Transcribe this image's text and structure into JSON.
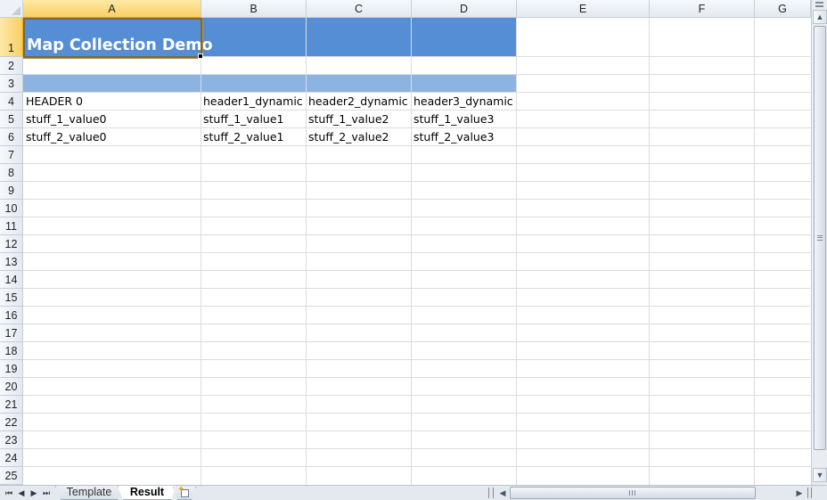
{
  "columns": [
    "A",
    "B",
    "C",
    "D",
    "E",
    "F",
    "G"
  ],
  "rows": [
    "1",
    "2",
    "3",
    "4",
    "5",
    "6",
    "7",
    "8",
    "9",
    "10",
    "11",
    "12",
    "13",
    "14",
    "15",
    "16",
    "17",
    "18",
    "19",
    "20",
    "21",
    "22",
    "23",
    "24",
    "25"
  ],
  "selection": {
    "column": "A",
    "row": "1"
  },
  "title": "Map Collection Demo",
  "colors": {
    "title_band": "#558ed5",
    "sub_band": "#8db3e2",
    "selection_header": "#f9cf63"
  },
  "table": {
    "header": [
      "HEADER 0",
      "header1_dynamic",
      "header2_dynamic",
      "header3_dynamic"
    ],
    "rows": [
      [
        "stuff_1_value0",
        "stuff_1_value1",
        "stuff_1_value2",
        "stuff_1_value3"
      ],
      [
        "stuff_2_value0",
        "stuff_2_value1",
        "stuff_2_value2",
        "stuff_2_value3"
      ]
    ]
  },
  "sheets": {
    "tabs": [
      "Template",
      "Result"
    ],
    "active": "Result"
  },
  "nav": {
    "first": "⏮",
    "prev": "◀",
    "next": "▶",
    "last": "⏭"
  }
}
